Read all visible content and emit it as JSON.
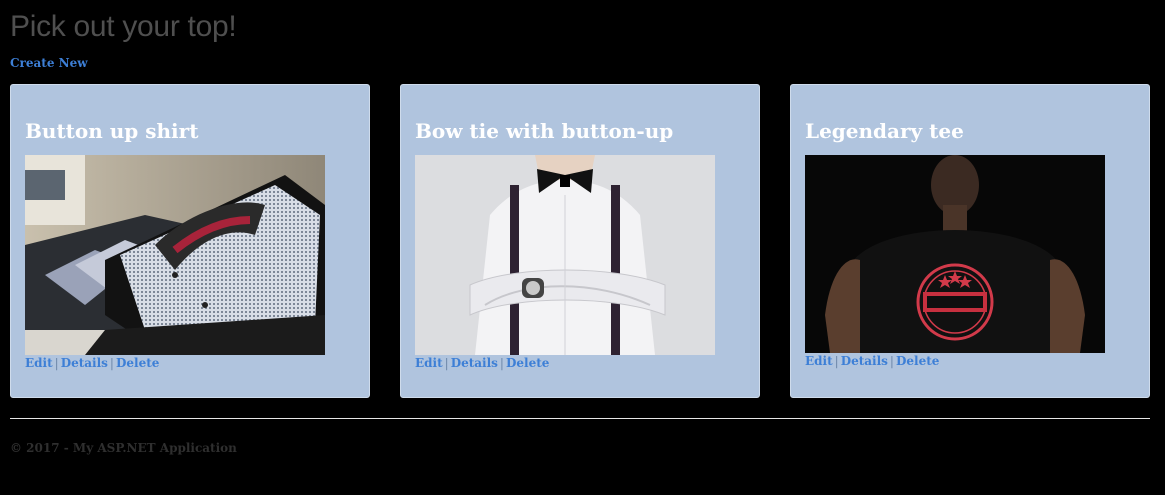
{
  "page": {
    "title": "Pick out your top!",
    "create_new_label": "Create New"
  },
  "cards": [
    {
      "title": "Button up shirt",
      "image_alt": "folded checked button up shirt",
      "links": {
        "edit": "Edit",
        "details": "Details",
        "delete": "Delete",
        "separator": "|"
      }
    },
    {
      "title": "Bow tie with button-up",
      "image_alt": "man in white shirt with bow tie and suspenders",
      "links": {
        "edit": "Edit",
        "details": "Details",
        "delete": "Delete",
        "separator": "|"
      }
    },
    {
      "title": "Legendary tee",
      "image_alt": "man wearing black Legendary t-shirt",
      "links": {
        "edit": "Edit",
        "details": "Details",
        "delete": "Delete",
        "separator": "|"
      }
    }
  ],
  "footer": {
    "text": "© 2017 - My ASP.NET Application"
  },
  "colors": {
    "background": "#000000",
    "card_background": "#b0c4de",
    "link": "#3d7fd6",
    "title_gray": "#4f4f4f"
  }
}
